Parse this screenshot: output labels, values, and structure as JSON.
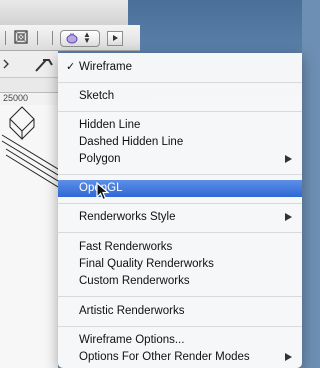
{
  "ruler": {
    "label": "25000"
  },
  "render_mode_menu": {
    "items": [
      {
        "label": "Wireframe",
        "checked": true
      },
      {
        "label": "Sketch"
      },
      {
        "label": "Hidden Line"
      },
      {
        "label": "Dashed Hidden Line"
      },
      {
        "label": "Polygon",
        "submenu": true
      },
      {
        "label": "OpenGL",
        "selected": true
      },
      {
        "label": "Renderworks Style",
        "submenu": true
      },
      {
        "label": "Fast Renderworks"
      },
      {
        "label": "Final Quality Renderworks"
      },
      {
        "label": "Custom Renderworks"
      },
      {
        "label": "Artistic Renderworks"
      },
      {
        "label": "Wireframe Options..."
      },
      {
        "label": "Options For Other Render Modes",
        "submenu": true
      }
    ],
    "check_glyph": "✓"
  },
  "colors": {
    "highlight": "#2f68d6",
    "menu_bg": "#fafafa"
  }
}
